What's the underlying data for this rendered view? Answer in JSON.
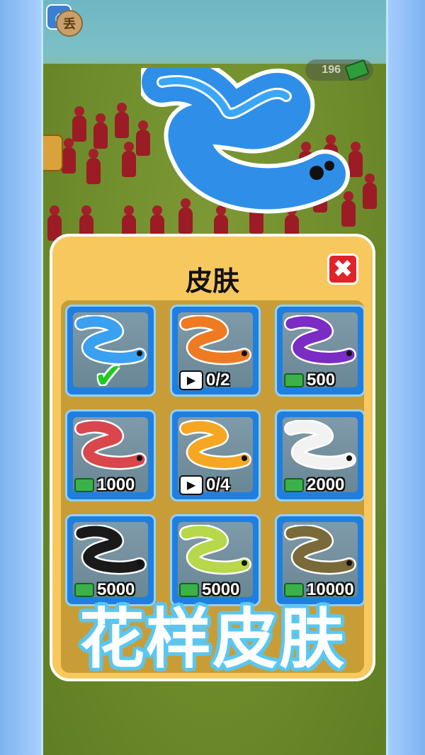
{
  "header": {
    "coins": "196",
    "home_icon": "home-icon",
    "shop_label": "丢"
  },
  "panel": {
    "title": "皮肤",
    "close_icon": "close-x-icon"
  },
  "skins": [
    {
      "color": "#3aa0f0",
      "status": "selected"
    },
    {
      "color": "#f07a22",
      "status": "video",
      "progress": "0/2"
    },
    {
      "color": "#7a2cc4",
      "status": "price",
      "price": "500"
    },
    {
      "color": "#d9464c",
      "status": "price",
      "price": "1000"
    },
    {
      "color": "#f5a623",
      "status": "video",
      "progress": "0/4"
    },
    {
      "color": "#f2f2f2",
      "status": "price",
      "price": "2000"
    },
    {
      "color": "#1a1a1a",
      "status": "price",
      "price": "5000"
    },
    {
      "color": "#b6d84a",
      "status": "price",
      "price": "5000"
    },
    {
      "color": "#7a6a3a",
      "status": "price",
      "price": "10000"
    }
  ],
  "promo_text": "花样皮肤"
}
